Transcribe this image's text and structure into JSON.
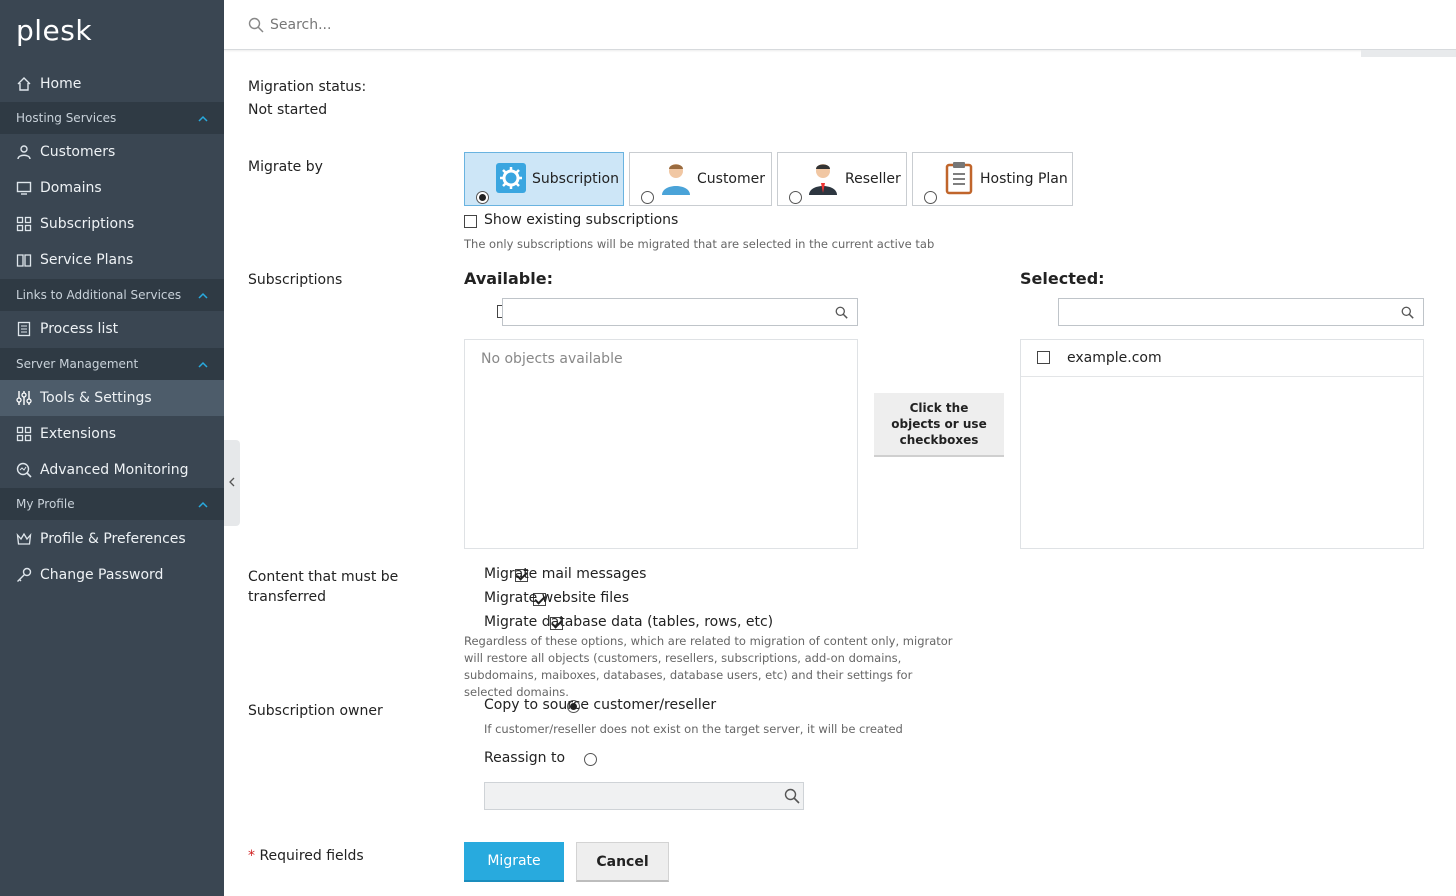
{
  "sidebar": {
    "logo": "plesk",
    "home": "Home",
    "sections": {
      "hosting": "Hosting Services",
      "links": "Links to Additional Services",
      "server": "Server Management",
      "profile": "My Profile"
    },
    "items": {
      "customers": "Customers",
      "domains": "Domains",
      "subscriptions": "Subscriptions",
      "service_plans": "Service Plans",
      "process_list": "Process list",
      "tools_settings": "Tools & Settings",
      "extensions": "Extensions",
      "advanced_monitoring": "Advanced Monitoring",
      "profile_prefs": "Profile & Preferences",
      "change_password": "Change Password"
    }
  },
  "search": {
    "placeholder": "Search..."
  },
  "form": {
    "migration_status_label": "Migration status:",
    "migration_status_value": "Not started",
    "migrate_by_label": "Migrate by",
    "migrate_by_options": [
      "Subscription",
      "Customer",
      "Reseller",
      "Hosting Plan"
    ],
    "migrate_by_selected": "Subscription",
    "show_existing_label": "Show existing subscriptions",
    "show_existing_hint": "The only subscriptions will be migrated that are selected in the current active tab",
    "subscriptions_label": "Subscriptions",
    "available_title": "Available:",
    "available_empty": "No objects available",
    "transfer_hint": "Click the objects or use checkboxes",
    "selected_title": "Selected:",
    "selected_items": [
      "example.com"
    ],
    "content_label": "Content that must be transferred",
    "content_options": [
      "Migrate mail messages",
      "Migrate website files",
      "Migrate database data (tables, rows, etc)"
    ],
    "content_hint": "Regardless of these options, which are related to migration of content only, migrator will restore all objects (customers, resellers, subscriptions, add-on domains, subdomains, maiboxes, databases, database users, etc) and their settings for selected domains.",
    "owner_label": "Subscription owner",
    "owner_copy": "Copy to source customer/reseller",
    "owner_copy_hint": "If customer/reseller does not exist on the target server, it will be created",
    "owner_reassign": "Reassign to",
    "required_star": "*",
    "required_fields": "Required fields",
    "migrate_button": "Migrate",
    "cancel_button": "Cancel"
  },
  "colors": {
    "sidebar_bg": "#3a4652",
    "primary": "#28aade",
    "selected_tab": "#cde6f7"
  }
}
